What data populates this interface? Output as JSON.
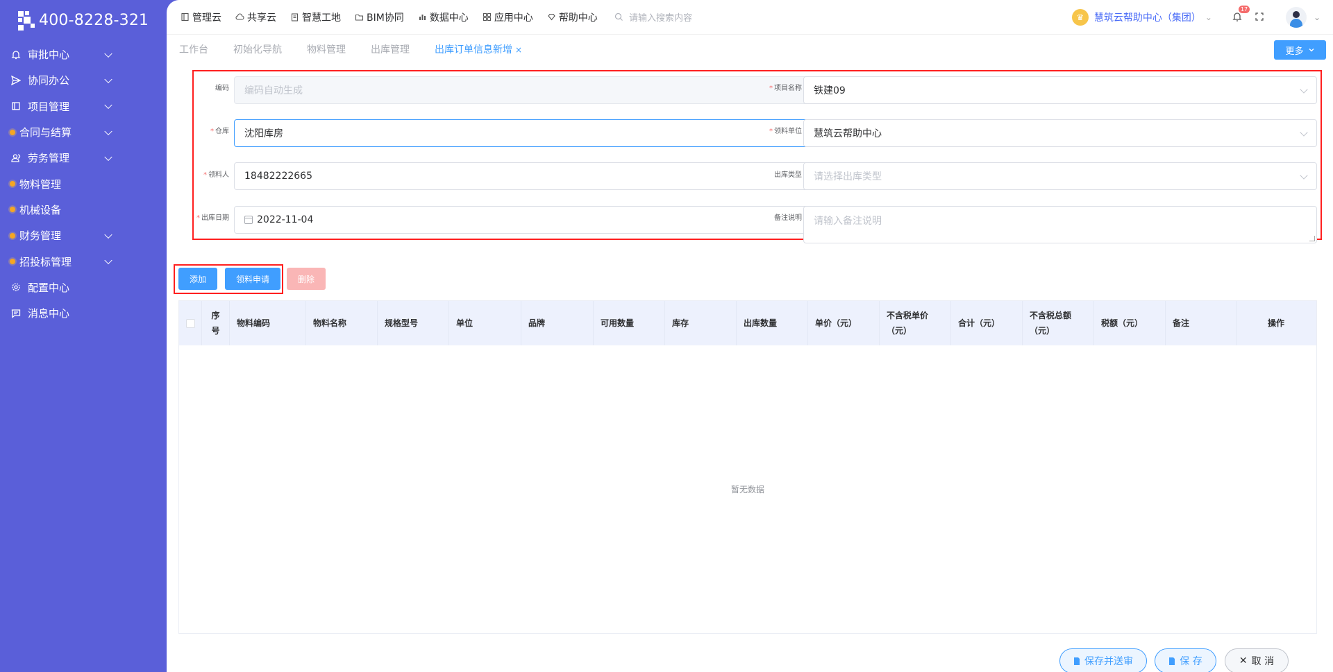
{
  "brand": {
    "phone": "400-8228-321"
  },
  "sidebar": {
    "items": [
      {
        "label": "审批中心",
        "icon": "bell-icon",
        "expandable": true
      },
      {
        "label": "协同办公",
        "icon": "send-icon",
        "expandable": true
      },
      {
        "label": "项目管理",
        "icon": "book-icon",
        "expandable": true
      },
      {
        "label": "合同与结算",
        "icon": "dot-icon",
        "expandable": true
      },
      {
        "label": "劳务管理",
        "icon": "users-icon",
        "expandable": true
      },
      {
        "label": "物料管理",
        "icon": "dot-icon",
        "expandable": false
      },
      {
        "label": "机械设备",
        "icon": "dot-icon",
        "expandable": false
      },
      {
        "label": "财务管理",
        "icon": "dot-icon",
        "expandable": true
      },
      {
        "label": "招投标管理",
        "icon": "dot-icon",
        "expandable": true
      },
      {
        "label": "配置中心",
        "icon": "gear-icon",
        "expandable": false
      },
      {
        "label": "消息中心",
        "icon": "message-icon",
        "expandable": false
      }
    ]
  },
  "topnav": {
    "items": [
      {
        "label": "管理云",
        "icon": "doc-icon"
      },
      {
        "label": "共享云",
        "icon": "cloud-icon"
      },
      {
        "label": "智慧工地",
        "icon": "clipboard-icon"
      },
      {
        "label": "BIM协同",
        "icon": "folder-icon"
      },
      {
        "label": "数据中心",
        "icon": "chart-icon"
      },
      {
        "label": "应用中心",
        "icon": "grid-icon"
      },
      {
        "label": "帮助中心",
        "icon": "diamond-icon"
      }
    ],
    "search_placeholder": "请输入搜索内容",
    "org_name": "慧筑云帮助中心（集团）",
    "notification_count": "17"
  },
  "tabs": {
    "items": [
      {
        "label": "工作台",
        "active": false
      },
      {
        "label": "初始化导航",
        "active": false
      },
      {
        "label": "物料管理",
        "active": false
      },
      {
        "label": "出库管理",
        "active": false
      },
      {
        "label": "出库订单信息新增",
        "active": true
      }
    ],
    "close_symbol": "×",
    "more_label": "更多"
  },
  "form": {
    "code": {
      "label": "编码",
      "placeholder": "编码自动生成",
      "required": false
    },
    "project": {
      "label": "项目名称",
      "value": "铁建09",
      "required": true
    },
    "warehouse": {
      "label": "仓库",
      "value": "沈阳库房",
      "required": true
    },
    "unit": {
      "label": "领料单位",
      "value": "慧筑云帮助中心",
      "required": true
    },
    "receiver": {
      "label": "领料人",
      "value": "18482222665",
      "required": true
    },
    "out_type": {
      "label": "出库类型",
      "placeholder": "请选择出库类型",
      "required": false
    },
    "out_date": {
      "label": "出库日期",
      "value": "2022-11-04",
      "required": true
    },
    "remark": {
      "label": "备注说明",
      "placeholder": "请输入备注说明",
      "required": false
    },
    "required_mark": "*"
  },
  "actions": {
    "add": "添加",
    "apply": "领料申请",
    "delete": "删除"
  },
  "table": {
    "columns": [
      "序号",
      "物料编码",
      "物料名称",
      "规格型号",
      "单位",
      "品牌",
      "可用数量",
      "库存",
      "出库数量",
      "单价（元）",
      "不含税单价（元）",
      "合计（元）",
      "不含税总额（元）",
      "税额（元）",
      "备注",
      "操作"
    ],
    "column_lines": {
      "index": [
        "序",
        "号"
      ],
      "excl_unit_price": [
        "不含税单价",
        "（元）"
      ],
      "excl_total": [
        "不含税总额",
        "（元）"
      ]
    },
    "empty_text": "暂无数据"
  },
  "footer": {
    "save_submit": "保存并送审",
    "save": "保 存",
    "cancel": "取 消"
  },
  "colors": {
    "sidebar_bg": "#5a5fd9",
    "primary": "#409eff",
    "highlight_border": "#ff1f1f",
    "header_bg": "#edf1fd"
  }
}
